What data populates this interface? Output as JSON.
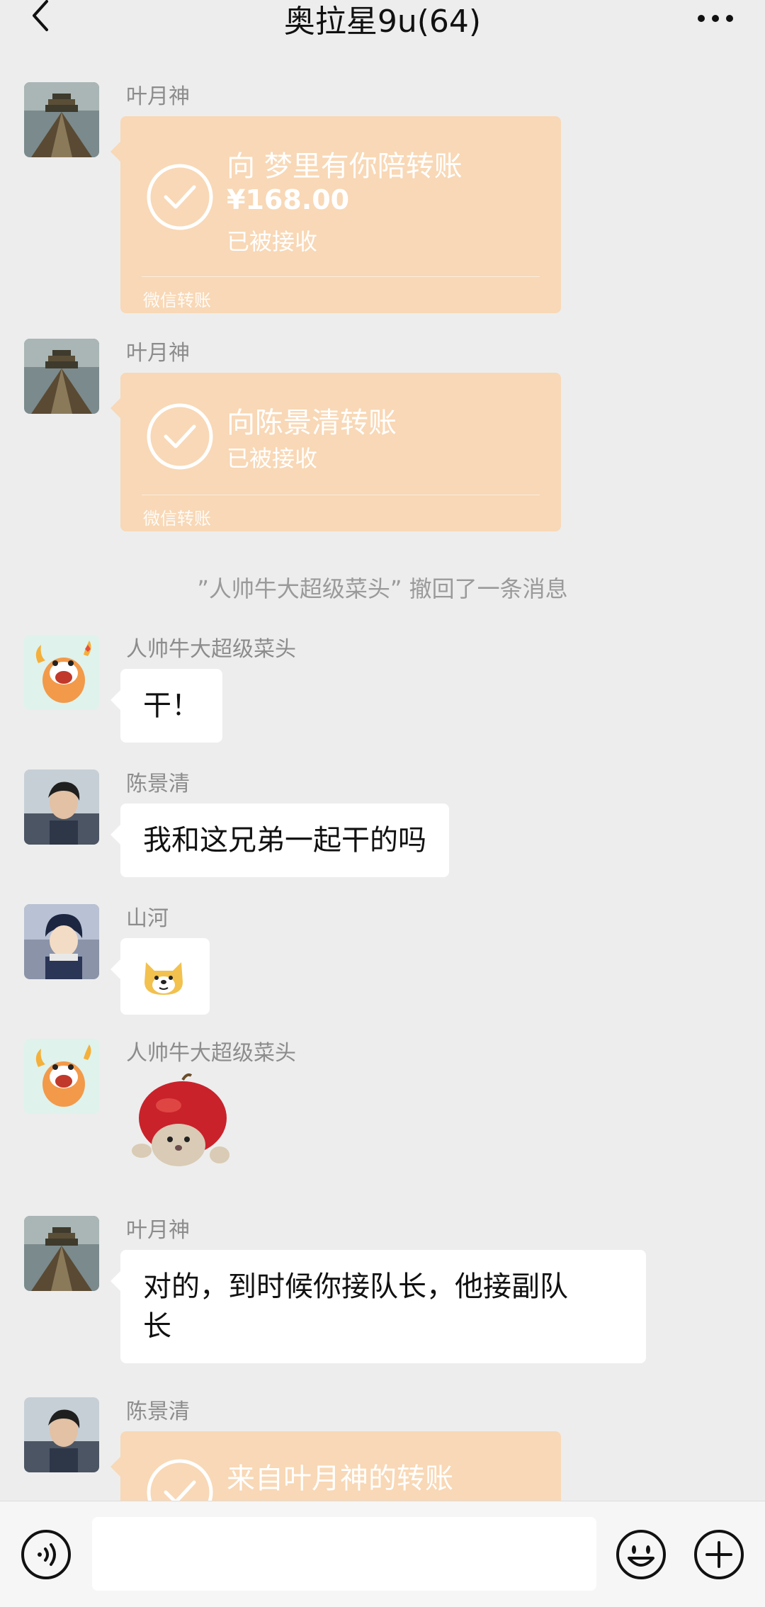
{
  "header": {
    "title": "奥拉星9u(64)"
  },
  "messages": [
    {
      "sender": "叶月神",
      "type": "transfer",
      "title": "向 梦里有你陪转账",
      "amount": "¥168.00",
      "status": "已被接收",
      "footer": "微信转账"
    },
    {
      "sender": "叶月神",
      "type": "transfer",
      "title": "向陈景清转账",
      "status": "已被接收",
      "footer": "微信转账"
    },
    {
      "type": "system",
      "text": "”人帅牛大超级菜头” 撤回了一条消息"
    },
    {
      "sender": "人帅牛大超级菜头",
      "type": "text",
      "text": "干！"
    },
    {
      "sender": "陈景清",
      "type": "text",
      "text": "我和这兄弟一起干的吗"
    },
    {
      "sender": "山河",
      "type": "emoji",
      "emoji": "doge-emoji"
    },
    {
      "sender": "人帅牛大超级菜头",
      "type": "sticker",
      "sticker": "apple-cat-sticker"
    },
    {
      "sender": "叶月神",
      "type": "text",
      "text_line1": "对的，到时候你接队长，他接副队",
      "text_line2": "长"
    },
    {
      "sender": "陈景清",
      "type": "transfer",
      "title": "来自叶月神的转账"
    }
  ],
  "input_bar": {
    "placeholder": ""
  },
  "icons": {
    "back": "chevron-left-icon",
    "more": "more-dots-icon",
    "voice": "voice-icon",
    "emoji": "emoji-icon",
    "plus": "plus-icon"
  },
  "colors": {
    "background": "#ededed",
    "transfer_bubble": "#f8d8b6",
    "bubble": "#ffffff",
    "sender_text": "#8c8c8c"
  }
}
